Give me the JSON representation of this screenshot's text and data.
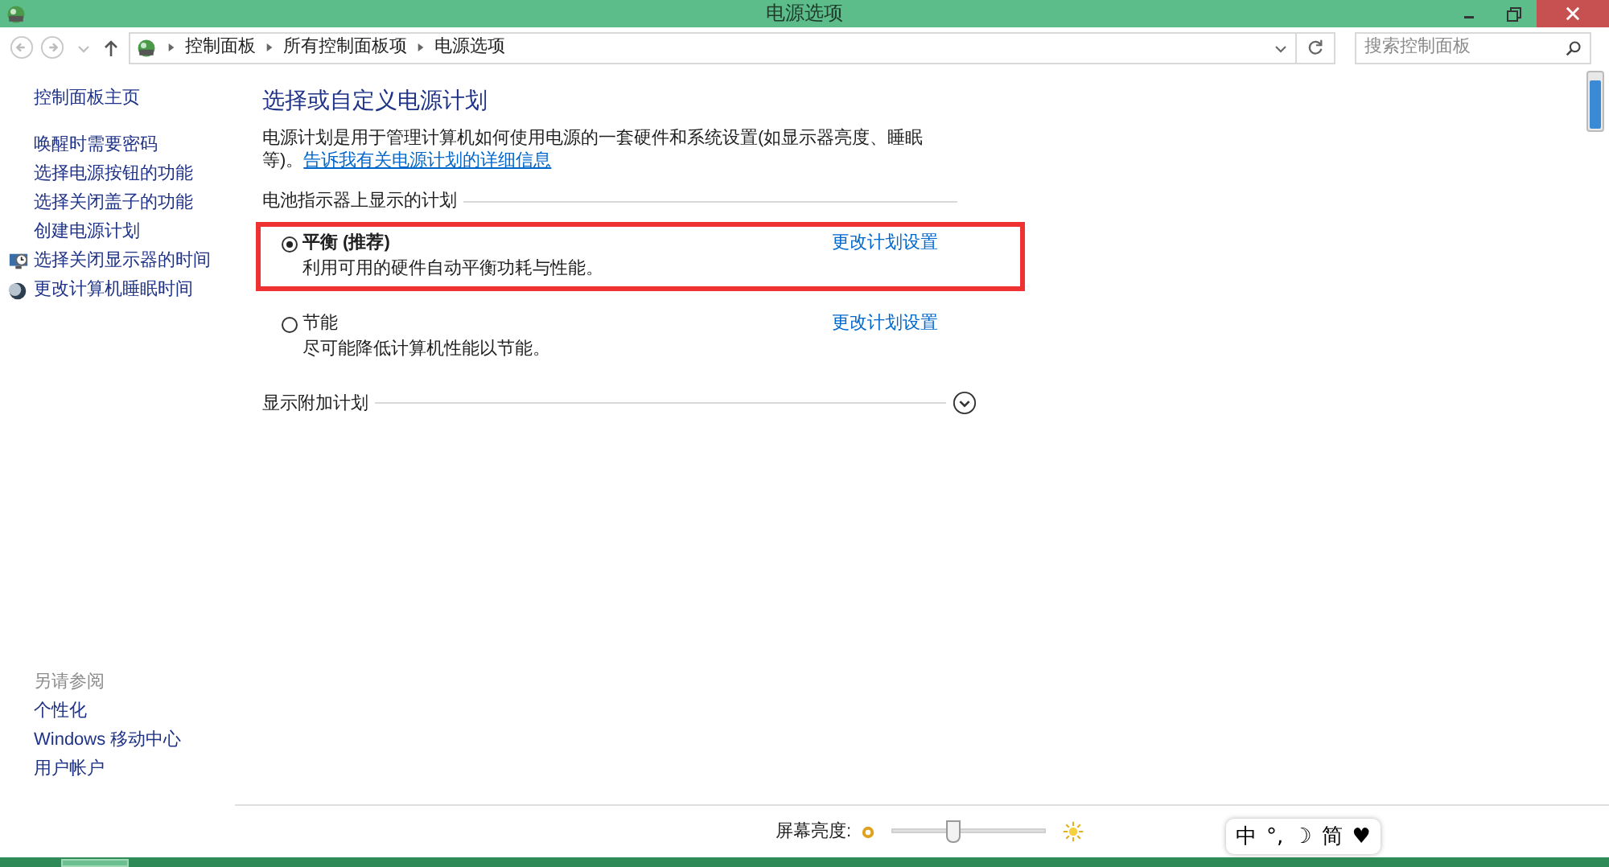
{
  "window": {
    "title": "电源选项"
  },
  "address_bar": {
    "breadcrumbs": [
      "控制面板",
      "所有控制面板项",
      "电源选项"
    ],
    "search_placeholder": "搜索控制面板"
  },
  "sidebar": {
    "home": "控制面板主页",
    "items": [
      {
        "label": "唤醒时需要密码",
        "kind": "plain"
      },
      {
        "label": "选择电源按钮的功能",
        "kind": "plain"
      },
      {
        "label": "选择关闭盖子的功能",
        "kind": "plain"
      },
      {
        "label": "创建电源计划",
        "kind": "plain"
      },
      {
        "label": "选择关闭显示器的时间",
        "kind": "iconed"
      },
      {
        "label": "更改计算机睡眠时间",
        "kind": "iconed"
      }
    ],
    "see_also_title": "另请参阅",
    "see_also": [
      "个性化",
      "Windows 移动中心",
      "用户帐户"
    ]
  },
  "main": {
    "heading": "选择或自定义电源计划",
    "intro": "电源计划是用于管理计算机如何使用电源的一套硬件和系统设置(如显示器亮度、睡眠等)。",
    "intro_link": "告诉我有关电源计划的详细信息",
    "group_title": "电池指示器上显示的计划",
    "plans": [
      {
        "name": "平衡 (推荐)",
        "description": "利用可用的硬件自动平衡功耗与性能。",
        "link": "更改计划设置",
        "selected": true,
        "highlighted": true
      },
      {
        "name": "节能",
        "description": "尽可能降低计算机性能以节能。",
        "link": "更改计划设置",
        "selected": false,
        "highlighted": false
      }
    ],
    "more_plans": "显示附加计划"
  },
  "brightness": {
    "label": "屏幕亮度:",
    "level": 0.39
  },
  "ime_bar": [
    "中",
    "°,",
    "☽",
    "简",
    "♥"
  ]
}
